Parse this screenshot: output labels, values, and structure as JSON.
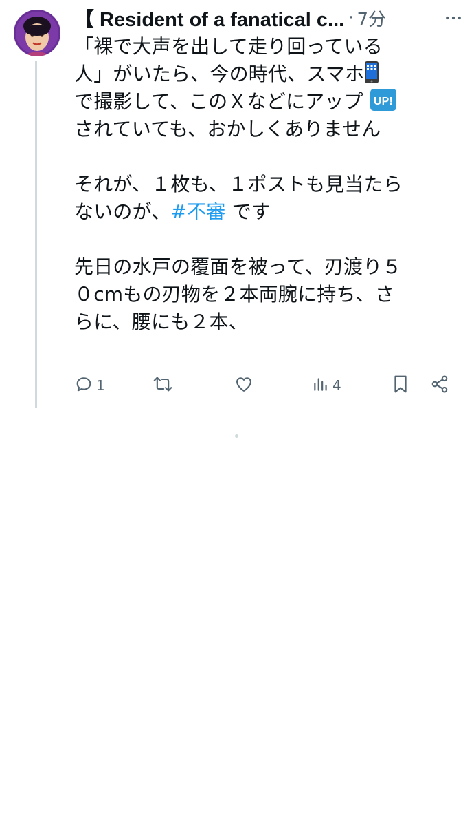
{
  "tweet": {
    "author": {
      "display_name": "【 Resident of a fanatical c...",
      "avatar_icon": "user-avatar-icon"
    },
    "separator": "·",
    "timestamp": "7分",
    "more_icon": "more-options-icon",
    "paragraphs": [
      {
        "lines": [
          {
            "text": "「裸で大声を出して走り回っている"
          },
          {
            "text": "人」がいたら、今の時代、スマホ",
            "emoji": "mobile-phone-emoji"
          },
          {
            "text": "で撮影して、このＸなどにアップ ",
            "emoji": "up-button-emoji",
            "emoji_label": "UP!"
          },
          {
            "text": "されていても、おかしくありません"
          }
        ]
      },
      {
        "lines": [
          {
            "text": "それが、１枚も、１ポストも見当たら"
          },
          {
            "text_before": "ないのが、",
            "hashtag": "#不審",
            "text_after": " です"
          }
        ]
      },
      {
        "lines": [
          {
            "text": "先日の水戸の覆面を被って、刃渡り５"
          },
          {
            "text": "０cmもの刃物を２本両腕に持ち、さ"
          },
          {
            "text": "らに、腰にも２本、"
          }
        ]
      }
    ],
    "actions": {
      "reply": {
        "icon": "reply-icon",
        "count": "1"
      },
      "retweet": {
        "icon": "retweet-icon",
        "count": ""
      },
      "like": {
        "icon": "like-icon",
        "count": ""
      },
      "views": {
        "icon": "views-icon",
        "count": "4"
      },
      "bookmark": {
        "icon": "bookmark-icon"
      },
      "share": {
        "icon": "share-icon"
      }
    },
    "colors": {
      "text": "#0f1419",
      "secondary": "#536471",
      "link": "#1d9bf0",
      "thread_line": "#cfd9de"
    }
  }
}
